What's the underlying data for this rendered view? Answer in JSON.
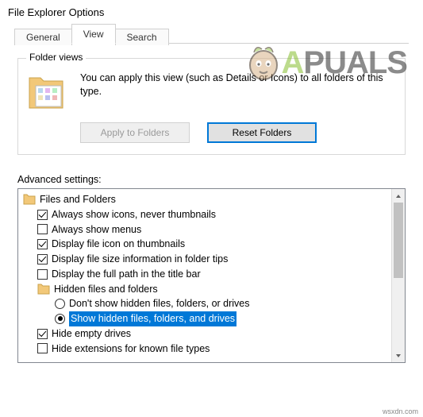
{
  "title": "File Explorer Options",
  "tabs": {
    "general": "General",
    "view": "View",
    "search": "Search"
  },
  "folderViews": {
    "legend": "Folder views",
    "description": "You can apply this view (such as Details or Icons) to all folders of this type.",
    "applyBtn": "Apply to Folders",
    "resetBtn": "Reset Folders"
  },
  "advanced": {
    "label": "Advanced settings:",
    "root": "Files and Folders",
    "items": {
      "alwaysIcons": "Always show icons, never thumbnails",
      "alwaysMenus": "Always show menus",
      "fileIconThumb": "Display file icon on thumbnails",
      "fileSizeTips": "Display file size information in folder tips",
      "fullPathTitle": "Display the full path in the title bar",
      "hiddenGroup": "Hidden files and folders",
      "dontShowHidden": "Don't show hidden files, folders, or drives",
      "showHidden": "Show hidden files, folders, and drives",
      "hideEmpty": "Hide empty drives",
      "hideExt": "Hide extensions for known file types"
    }
  },
  "watermark": {
    "part1": "A",
    "part2": "PUALS"
  },
  "attribution": "wsxdn.com"
}
